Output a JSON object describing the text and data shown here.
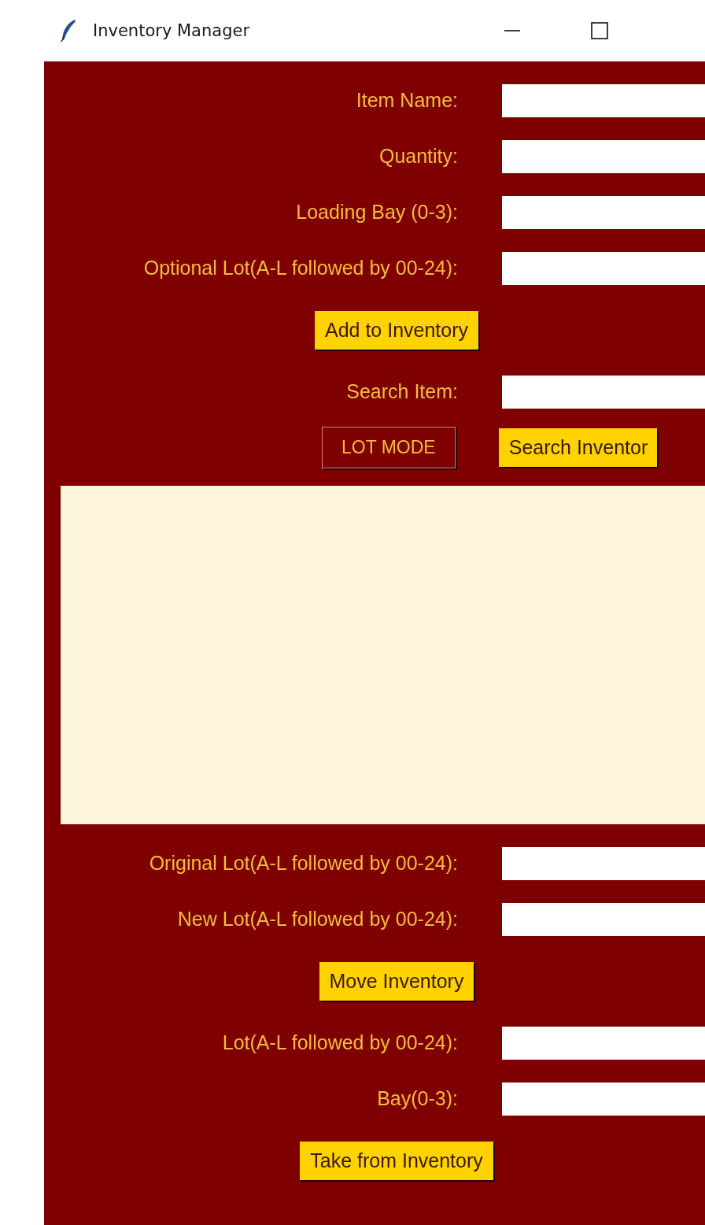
{
  "window": {
    "title": "Inventory Manager"
  },
  "add_form": {
    "fields": [
      {
        "label": "Item Name:"
      },
      {
        "label": "Quantity:"
      },
      {
        "label": "Loading Bay (0-3):"
      },
      {
        "label": "Optional Lot(A-L followed by 00-24):"
      }
    ],
    "button": "Add to Inventory"
  },
  "search": {
    "label": "Search Item:",
    "lot_mode_button": "LOT MODE",
    "search_button": "Search Inventor"
  },
  "move_form": {
    "fields": [
      {
        "label": "Original Lot(A-L followed by 00-24):"
      },
      {
        "label": "New Lot(A-L followed by 00-24):"
      }
    ],
    "button": "Move Inventory"
  },
  "take_form": {
    "fields": [
      {
        "label": "Lot(A-L followed by 00-24):"
      },
      {
        "label": "Bay(0-3):"
      }
    ],
    "button": "Take from Inventory"
  }
}
